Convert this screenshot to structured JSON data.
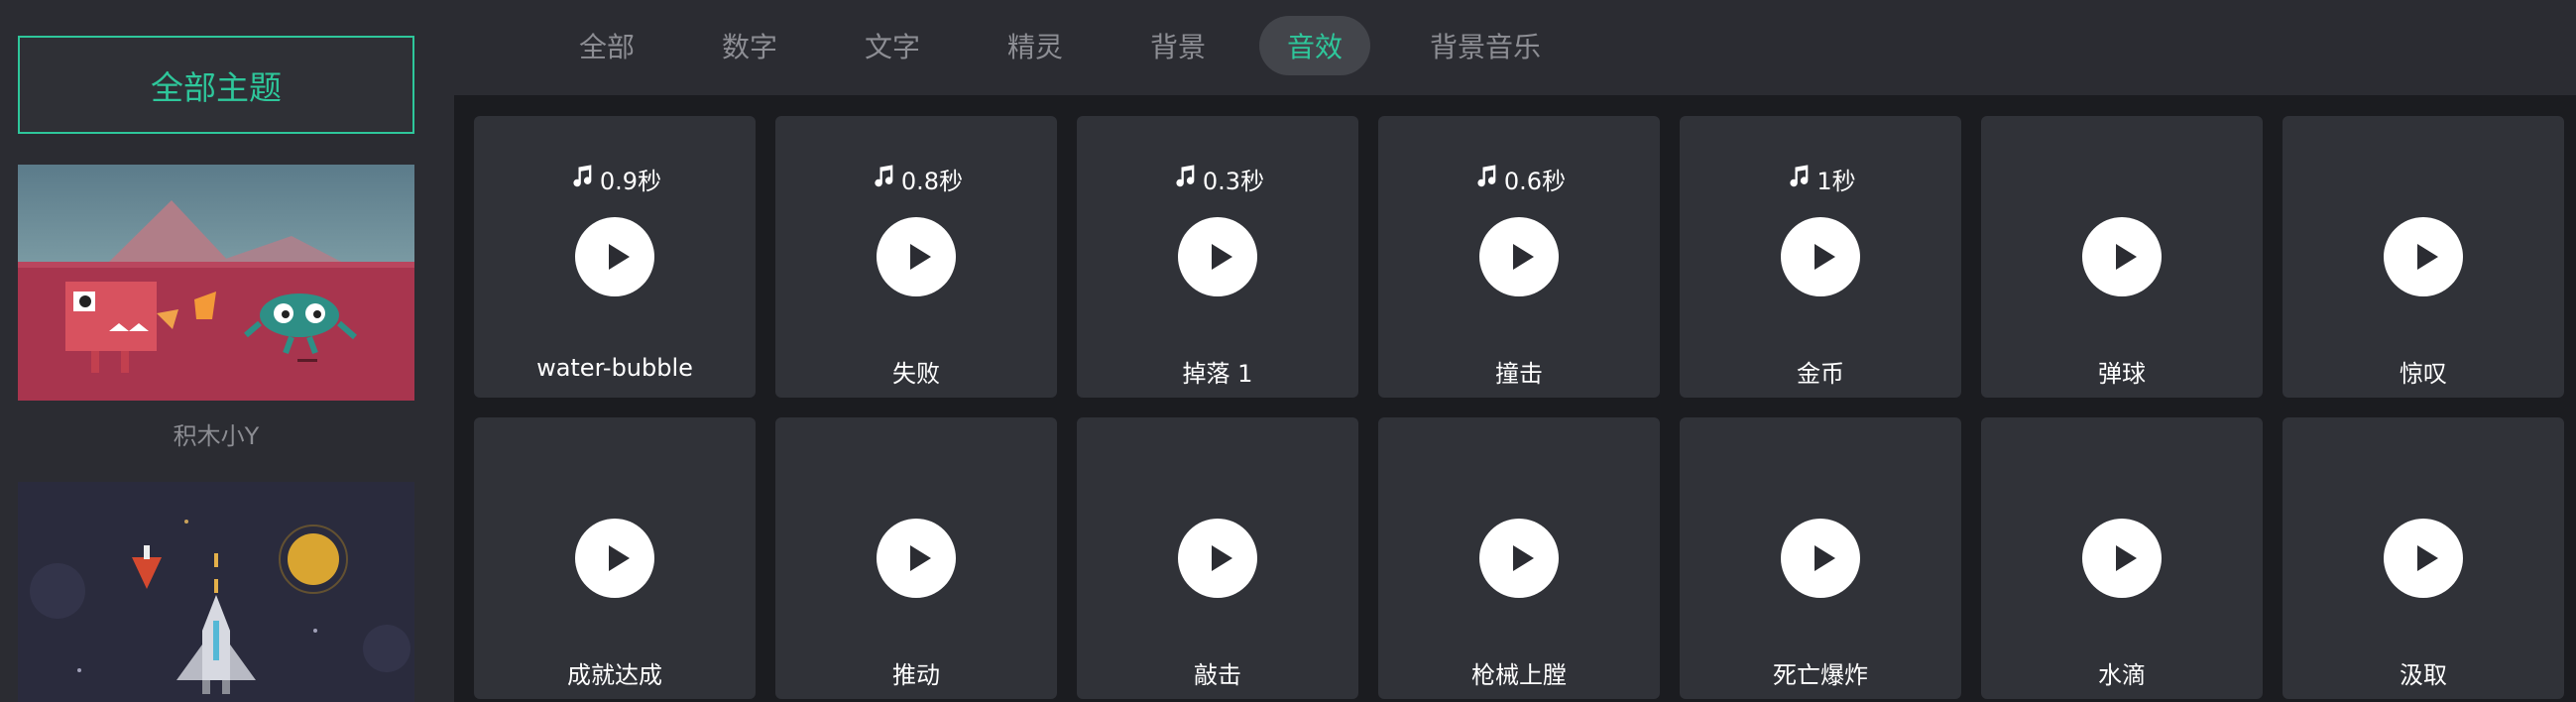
{
  "sidebar": {
    "all_themes": "全部主题",
    "themes": [
      {
        "label": "积木小Y"
      },
      {
        "label": ""
      }
    ]
  },
  "tabs": [
    {
      "label": "全部",
      "active": false
    },
    {
      "label": "数字",
      "active": false
    },
    {
      "label": "文字",
      "active": false
    },
    {
      "label": "精灵",
      "active": false
    },
    {
      "label": "背景",
      "active": false
    },
    {
      "label": "音效",
      "active": true
    },
    {
      "label": "背景音乐",
      "active": false
    }
  ],
  "colors": {
    "accent": "#2ec79b",
    "card": "#303238",
    "sidebar": "#2b2c32",
    "background": "#1b1c20"
  },
  "sounds": [
    {
      "name": "water-bubble",
      "duration": "0.9秒",
      "icon": "music-note-icon"
    },
    {
      "name": "失败",
      "duration": "0.8秒",
      "icon": "music-note-icon"
    },
    {
      "name": "掉落 1",
      "duration": "0.3秒",
      "icon": "music-note-icon"
    },
    {
      "name": "撞击",
      "duration": "0.6秒",
      "icon": "music-note-icon"
    },
    {
      "name": "金币",
      "duration": "1秒",
      "icon": "music-note-icon"
    },
    {
      "name": "弹球",
      "duration": ""
    },
    {
      "name": "惊叹",
      "duration": ""
    },
    {
      "name": "成就达成",
      "duration": ""
    },
    {
      "name": "推动",
      "duration": ""
    },
    {
      "name": "敲击",
      "duration": ""
    },
    {
      "name": "枪械上膛",
      "duration": ""
    },
    {
      "name": "死亡爆炸",
      "duration": ""
    },
    {
      "name": "水滴",
      "duration": ""
    },
    {
      "name": "汲取",
      "duration": ""
    }
  ]
}
